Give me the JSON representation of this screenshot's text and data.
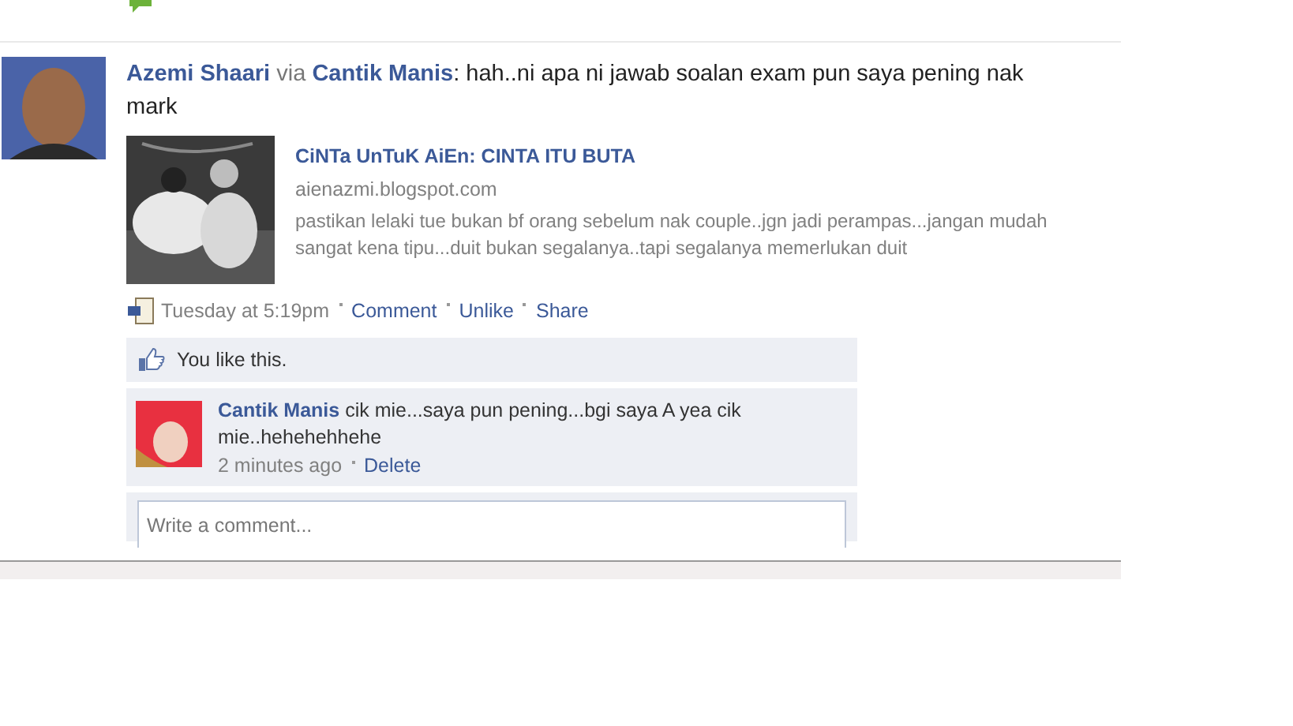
{
  "post": {
    "author": "Azemi Shaari",
    "via": "via",
    "app": "Cantik Manis",
    "message": ": hah..ni apa ni jawab soalan exam pun saya pening nak mark",
    "attachment": {
      "kind": "picture",
      "title": "CiNTa UnTuK AiEn: CINTA ITU BUTA",
      "domain": "aienazmi.blogspot.com",
      "description": "pastikan lelaki tue bukan bf orang sebelum nak couple..jgn jadi perampas...jangan mudah sangat kena tipu...duit bukan segalanya..tapi segalanya memerlukan duit"
    },
    "time": "Tuesday at 5:19pm",
    "actions": [
      {
        "label": "Comment"
      },
      {
        "label": "Unlike"
      },
      {
        "label": "Share"
      }
    ],
    "likes": "You like this.",
    "comments": [
      {
        "author": "Cantik Manis",
        "text": "cik mie...saya pun pening...bgi saya A yea cik mie..hehehehhehe",
        "time": "2 minutes ago",
        "action": "Delete"
      }
    ],
    "comment_box": {
      "placeholder": "Write a comment..."
    }
  }
}
